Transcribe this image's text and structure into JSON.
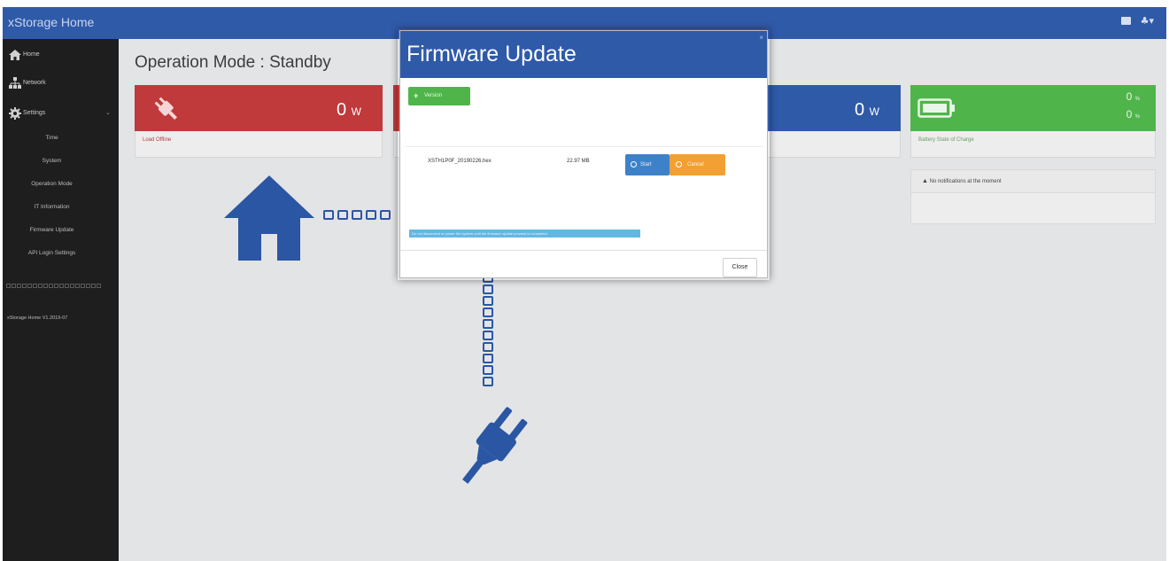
{
  "app": {
    "title": "xStorage Home",
    "accent": "#2f5aa8"
  },
  "topbar": {
    "mail_icon": "envelope-icon",
    "user_menu": "♣▾"
  },
  "sidebar": {
    "items": [
      {
        "label": "Home",
        "icon": "home-icon"
      },
      {
        "label": "Network",
        "icon": "network-icon"
      },
      {
        "label": "Settings",
        "icon": "gear-icon"
      }
    ],
    "sub_items": [
      "Time",
      "System",
      "Operation Mode",
      "IT Information",
      "Firmware Update",
      "API Login Settings"
    ],
    "version": "xStorage Home V1.2019-07"
  },
  "main": {
    "operation_mode": "Operation Mode : Standby",
    "tiles": [
      {
        "value": "0",
        "unit": "W",
        "footer": "Load Offline",
        "color": "#c0393b"
      },
      {
        "value": "0",
        "unit": "W",
        "footer": "",
        "color": "#2f5aa8"
      },
      {
        "value_a": "0",
        "value_b": "0",
        "unit": "%",
        "footer": "Battery State of Charge",
        "color": "#4fb54a"
      }
    ],
    "notifications": {
      "text": "No notifications at the moment"
    }
  },
  "modal": {
    "title": "Firmware Update",
    "version_button": "Version",
    "file": {
      "name": "XSTH1P0F_20190226.hex",
      "size": "22.97 MB"
    },
    "start_button": "Start",
    "cancel_button": "Cancel",
    "notice": "Do not disconnect or power the system until the firmware update process is completed",
    "close_button": "Close"
  }
}
